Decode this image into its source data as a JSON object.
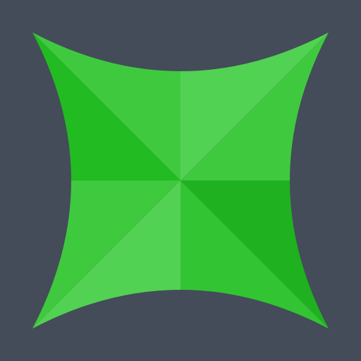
{
  "icon": {
    "name": "four-point-star-logo",
    "colors": {
      "background": "#434c58",
      "top_left_upper": "#3fc93f",
      "top_left_lower": "#22bb22",
      "top_right_upper": "#52d252",
      "top_right_lower": "#3fc93f",
      "bottom_left_upper": "#3fc93f",
      "bottom_left_lower": "#52d252",
      "bottom_right_upper": "#1fb11f",
      "bottom_right_lower": "#33c433"
    }
  }
}
